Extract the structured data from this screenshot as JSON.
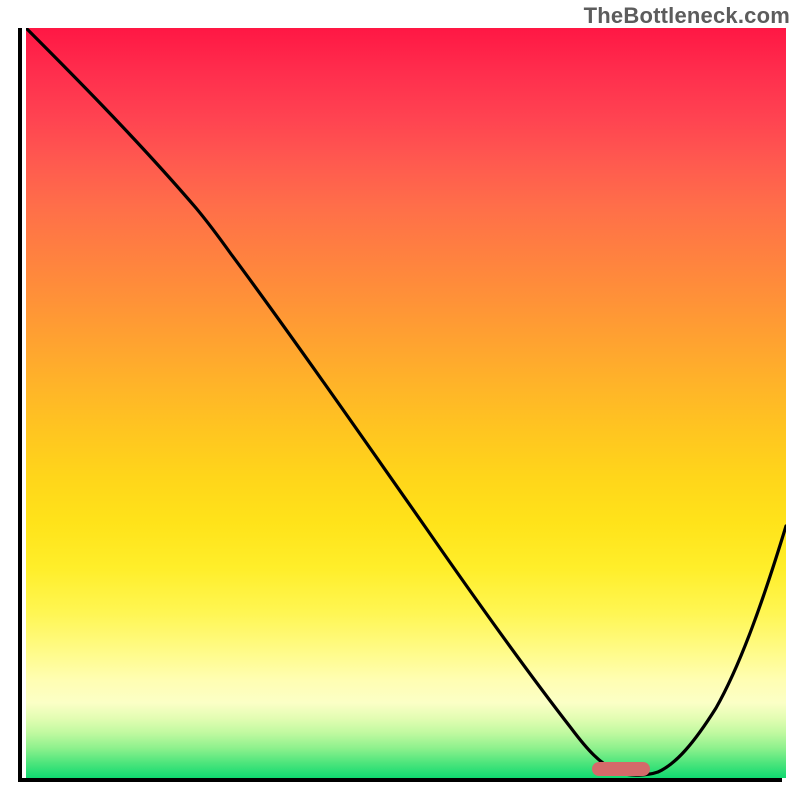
{
  "watermark": "TheBottleneck.com",
  "chart_data": {
    "type": "line",
    "title": "",
    "xlabel": "",
    "ylabel": "",
    "xlim": [
      0,
      100
    ],
    "ylim": [
      0,
      100
    ],
    "x": [
      0,
      5,
      10,
      15,
      20,
      24,
      28,
      32,
      36,
      40,
      44,
      48,
      52,
      56,
      60,
      64,
      68,
      72,
      76,
      80,
      82,
      84,
      88,
      92,
      96,
      100
    ],
    "values": [
      100,
      94,
      88,
      82,
      76,
      70,
      64,
      56,
      49,
      42,
      36,
      29,
      23,
      17,
      12,
      8,
      4,
      2,
      0.5,
      0,
      0.3,
      1,
      5,
      12,
      22,
      34
    ],
    "gradient_top_color": "#ff1744",
    "gradient_bottom_color": "#10d970",
    "marker": {
      "x_start": 76,
      "x_end": 82,
      "color": "#d46a6a"
    }
  }
}
